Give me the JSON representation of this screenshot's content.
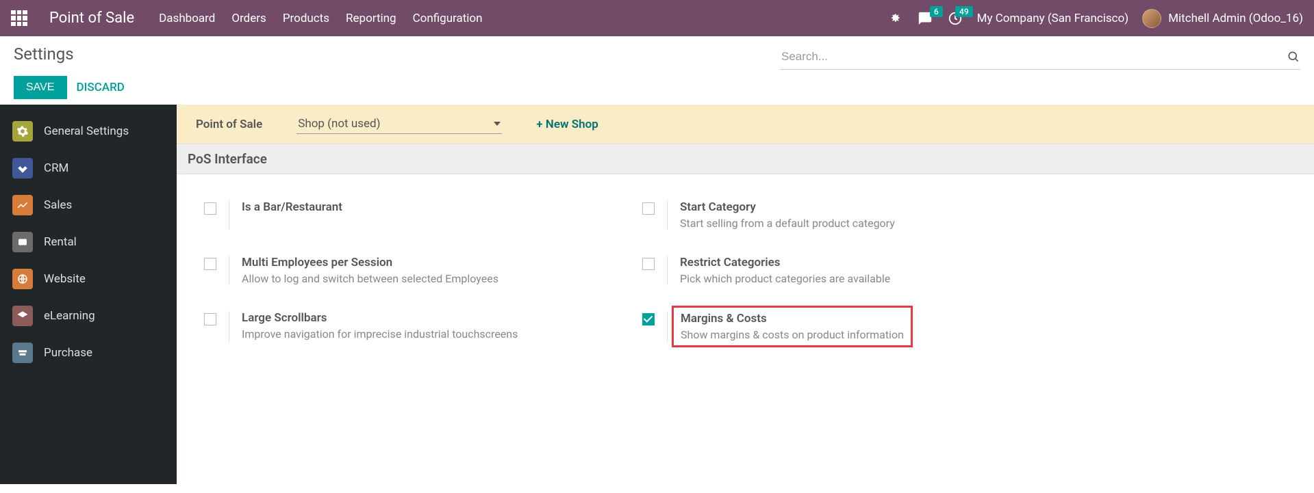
{
  "topnav": {
    "app_title": "Point of Sale",
    "menu": [
      "Dashboard",
      "Orders",
      "Products",
      "Reporting",
      "Configuration"
    ],
    "messages_badge": "6",
    "activities_badge": "49",
    "company": "My Company (San Francisco)",
    "user": "Mitchell Admin (Odoo_16)"
  },
  "control": {
    "title": "Settings",
    "save": "SAVE",
    "discard": "DISCARD",
    "search_placeholder": "Search..."
  },
  "sidebar": {
    "items": [
      {
        "label": "General Settings"
      },
      {
        "label": "CRM"
      },
      {
        "label": "Sales"
      },
      {
        "label": "Rental"
      },
      {
        "label": "Website"
      },
      {
        "label": "eLearning"
      },
      {
        "label": "Purchase"
      }
    ]
  },
  "posbar": {
    "label": "Point of Sale",
    "selected": "Shop (not used)",
    "new_shop": "+ New Shop"
  },
  "section": {
    "title": "PoS Interface"
  },
  "settings": {
    "bar_restaurant": {
      "title": "Is a Bar/Restaurant"
    },
    "start_category": {
      "title": "Start Category",
      "desc": "Start selling from a default product category"
    },
    "multi_emp": {
      "title": "Multi Employees per Session",
      "desc": "Allow to log and switch between selected Employees"
    },
    "restrict_cat": {
      "title": "Restrict Categories",
      "desc": "Pick which product categories are available"
    },
    "large_scroll": {
      "title": "Large Scrollbars",
      "desc": "Improve navigation for imprecise industrial touchscreens"
    },
    "margins": {
      "title": "Margins & Costs",
      "desc": "Show margins & costs on product information"
    }
  }
}
